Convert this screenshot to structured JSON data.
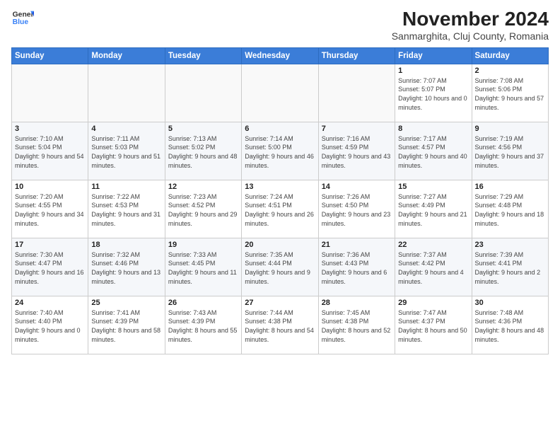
{
  "header": {
    "logo_line1": "General",
    "logo_line2": "Blue",
    "title": "November 2024",
    "subtitle": "Sanmarghita, Cluj County, Romania"
  },
  "weekdays": [
    "Sunday",
    "Monday",
    "Tuesday",
    "Wednesday",
    "Thursday",
    "Friday",
    "Saturday"
  ],
  "weeks": [
    [
      {
        "day": "",
        "info": ""
      },
      {
        "day": "",
        "info": ""
      },
      {
        "day": "",
        "info": ""
      },
      {
        "day": "",
        "info": ""
      },
      {
        "day": "",
        "info": ""
      },
      {
        "day": "1",
        "info": "Sunrise: 7:07 AM\nSunset: 5:07 PM\nDaylight: 10 hours and 0 minutes."
      },
      {
        "day": "2",
        "info": "Sunrise: 7:08 AM\nSunset: 5:06 PM\nDaylight: 9 hours and 57 minutes."
      }
    ],
    [
      {
        "day": "3",
        "info": "Sunrise: 7:10 AM\nSunset: 5:04 PM\nDaylight: 9 hours and 54 minutes."
      },
      {
        "day": "4",
        "info": "Sunrise: 7:11 AM\nSunset: 5:03 PM\nDaylight: 9 hours and 51 minutes."
      },
      {
        "day": "5",
        "info": "Sunrise: 7:13 AM\nSunset: 5:02 PM\nDaylight: 9 hours and 48 minutes."
      },
      {
        "day": "6",
        "info": "Sunrise: 7:14 AM\nSunset: 5:00 PM\nDaylight: 9 hours and 46 minutes."
      },
      {
        "day": "7",
        "info": "Sunrise: 7:16 AM\nSunset: 4:59 PM\nDaylight: 9 hours and 43 minutes."
      },
      {
        "day": "8",
        "info": "Sunrise: 7:17 AM\nSunset: 4:57 PM\nDaylight: 9 hours and 40 minutes."
      },
      {
        "day": "9",
        "info": "Sunrise: 7:19 AM\nSunset: 4:56 PM\nDaylight: 9 hours and 37 minutes."
      }
    ],
    [
      {
        "day": "10",
        "info": "Sunrise: 7:20 AM\nSunset: 4:55 PM\nDaylight: 9 hours and 34 minutes."
      },
      {
        "day": "11",
        "info": "Sunrise: 7:22 AM\nSunset: 4:53 PM\nDaylight: 9 hours and 31 minutes."
      },
      {
        "day": "12",
        "info": "Sunrise: 7:23 AM\nSunset: 4:52 PM\nDaylight: 9 hours and 29 minutes."
      },
      {
        "day": "13",
        "info": "Sunrise: 7:24 AM\nSunset: 4:51 PM\nDaylight: 9 hours and 26 minutes."
      },
      {
        "day": "14",
        "info": "Sunrise: 7:26 AM\nSunset: 4:50 PM\nDaylight: 9 hours and 23 minutes."
      },
      {
        "day": "15",
        "info": "Sunrise: 7:27 AM\nSunset: 4:49 PM\nDaylight: 9 hours and 21 minutes."
      },
      {
        "day": "16",
        "info": "Sunrise: 7:29 AM\nSunset: 4:48 PM\nDaylight: 9 hours and 18 minutes."
      }
    ],
    [
      {
        "day": "17",
        "info": "Sunrise: 7:30 AM\nSunset: 4:47 PM\nDaylight: 9 hours and 16 minutes."
      },
      {
        "day": "18",
        "info": "Sunrise: 7:32 AM\nSunset: 4:46 PM\nDaylight: 9 hours and 13 minutes."
      },
      {
        "day": "19",
        "info": "Sunrise: 7:33 AM\nSunset: 4:45 PM\nDaylight: 9 hours and 11 minutes."
      },
      {
        "day": "20",
        "info": "Sunrise: 7:35 AM\nSunset: 4:44 PM\nDaylight: 9 hours and 9 minutes."
      },
      {
        "day": "21",
        "info": "Sunrise: 7:36 AM\nSunset: 4:43 PM\nDaylight: 9 hours and 6 minutes."
      },
      {
        "day": "22",
        "info": "Sunrise: 7:37 AM\nSunset: 4:42 PM\nDaylight: 9 hours and 4 minutes."
      },
      {
        "day": "23",
        "info": "Sunrise: 7:39 AM\nSunset: 4:41 PM\nDaylight: 9 hours and 2 minutes."
      }
    ],
    [
      {
        "day": "24",
        "info": "Sunrise: 7:40 AM\nSunset: 4:40 PM\nDaylight: 9 hours and 0 minutes."
      },
      {
        "day": "25",
        "info": "Sunrise: 7:41 AM\nSunset: 4:39 PM\nDaylight: 8 hours and 58 minutes."
      },
      {
        "day": "26",
        "info": "Sunrise: 7:43 AM\nSunset: 4:39 PM\nDaylight: 8 hours and 55 minutes."
      },
      {
        "day": "27",
        "info": "Sunrise: 7:44 AM\nSunset: 4:38 PM\nDaylight: 8 hours and 54 minutes."
      },
      {
        "day": "28",
        "info": "Sunrise: 7:45 AM\nSunset: 4:38 PM\nDaylight: 8 hours and 52 minutes."
      },
      {
        "day": "29",
        "info": "Sunrise: 7:47 AM\nSunset: 4:37 PM\nDaylight: 8 hours and 50 minutes."
      },
      {
        "day": "30",
        "info": "Sunrise: 7:48 AM\nSunset: 4:36 PM\nDaylight: 8 hours and 48 minutes."
      }
    ]
  ]
}
